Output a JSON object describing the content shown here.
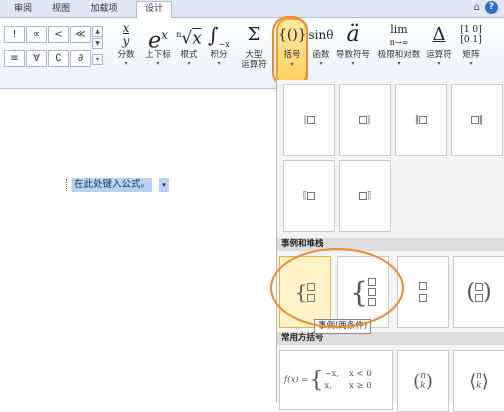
{
  "tabs": [
    "审阅",
    "视图",
    "加载项",
    "设计"
  ],
  "active_tab": "设计",
  "window_icons": {
    "minimize_ribbon": "⌂",
    "help": "?"
  },
  "symbols": [
    "!",
    "∝",
    "<",
    "≪",
    "≡",
    "∀",
    "∁",
    "∂"
  ],
  "groups": [
    {
      "glyph": "x/y",
      "label": "分数"
    },
    {
      "glyph": "eˣ",
      "label": "上下标"
    },
    {
      "glyph": "ⁿ√x",
      "label": "根式"
    },
    {
      "glyph": "∫",
      "label": "积分"
    },
    {
      "glyph": "Σ",
      "label": "大型\n运算符"
    },
    {
      "glyph": "{()}",
      "label": "括号"
    },
    {
      "glyph": "sinθ",
      "label": "函数"
    },
    {
      "glyph": "ä",
      "label": "导数符号"
    },
    {
      "glyph": "lim",
      "label": "极限和对数"
    },
    {
      "glyph": "Δ",
      "label": "运算符"
    },
    {
      "glyph": "[10 01]",
      "label": "矩阵"
    }
  ],
  "equation": {
    "placeholder": "在此处键入公式。"
  },
  "gallery": {
    "section_cases": "事例和堆栈",
    "section_common": "常用方括号",
    "tooltip": "事例(两条件)",
    "formula": {
      "lhs": "f(x) =",
      "c1": "−x,",
      "cond1": "x < 0",
      "c2": "x,",
      "cond2": "x ≥ 0"
    },
    "binom": {
      "n": "n",
      "k": "k"
    }
  },
  "colors": {
    "accent_ring": "#ee8a2a",
    "selected_button": "#ffcf5a",
    "selection_highlight": "#b7d1f0"
  }
}
